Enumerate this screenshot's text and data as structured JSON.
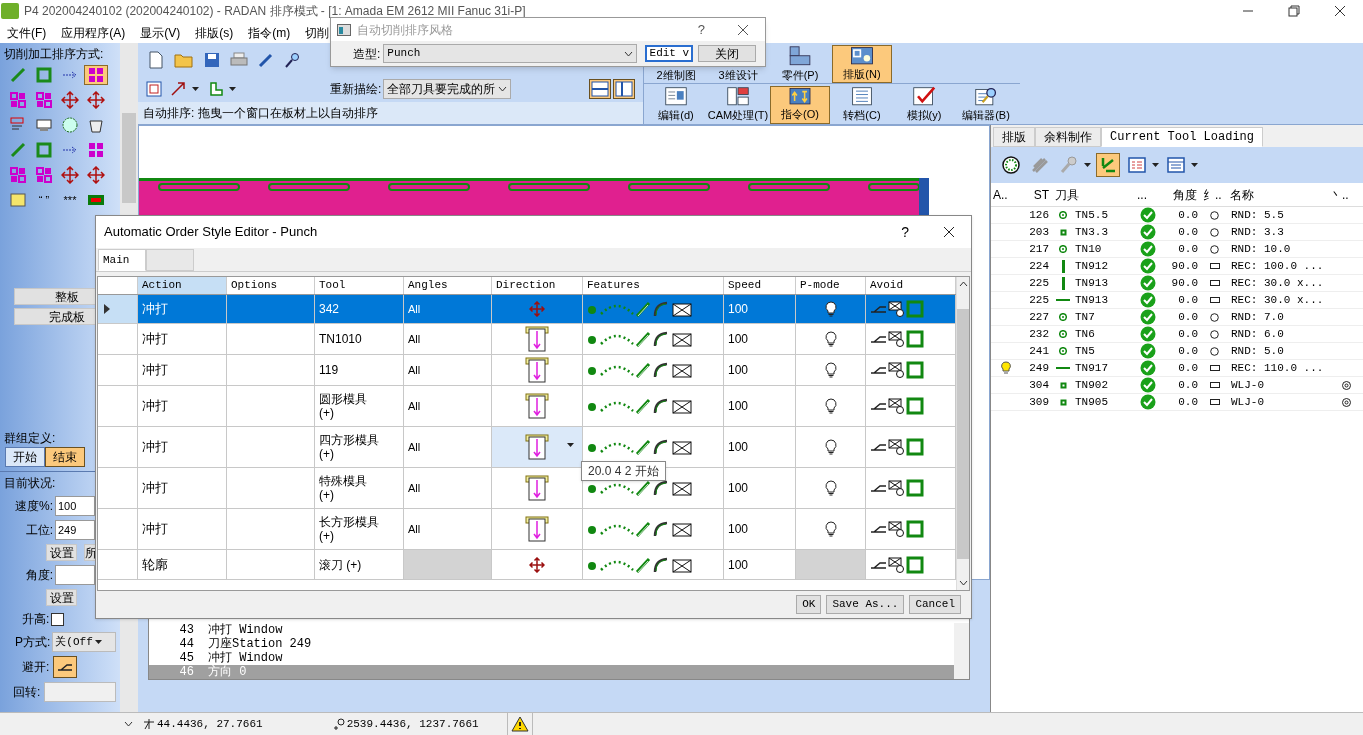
{
  "main_window": {
    "title": "P4 202004240102 (202004240102) - RADAN 排序模式 - [1: Amada EM 2612 MII Fanuc 31i-P]"
  },
  "menu": [
    "文件(F)",
    "应用程序(A)",
    "显示(V)",
    "排版(s)",
    "指令(m)",
    "切削"
  ],
  "left_panel": {
    "title": "切削加工排序方式:",
    "sort_tools": [
      {
        "kind": "icon",
        "selected": false
      },
      {
        "kind": "icon",
        "selected": false
      },
      {
        "kind": "icon",
        "selected": false
      },
      {
        "kind": "icon",
        "selected": true
      },
      {
        "kind": "icon",
        "selected": false
      },
      {
        "kind": "icon",
        "selected": false
      },
      {
        "kind": "icon",
        "selected": false
      },
      {
        "kind": "icon",
        "selected": false
      },
      {
        "kind": "icon",
        "selected": false
      },
      {
        "kind": "icon",
        "selected": false
      },
      {
        "kind": "icon",
        "selected": false
      },
      {
        "kind": "icon",
        "selected": false
      },
      {
        "kind": "icon",
        "selected": false
      },
      {
        "kind": "icon",
        "selected": false
      },
      {
        "kind": "icon",
        "selected": false
      },
      {
        "kind": "icon",
        "selected": false
      },
      {
        "kind": "icon",
        "selected": false
      },
      {
        "kind": "icon",
        "selected": false
      },
      {
        "kind": "icon",
        "selected": false
      },
      {
        "kind": "icon",
        "selected": false
      },
      {
        "kind": "icon",
        "selected": false
      },
      {
        "kind": "text",
        "label": "“ ”",
        "selected": false
      },
      {
        "kind": "text",
        "label": "***",
        "selected": false
      },
      {
        "kind": "icon",
        "selected": false
      }
    ],
    "buttons": [
      "整板",
      "完成板"
    ],
    "group_label": "群组定义:",
    "group_buttons": [
      {
        "label": "开始",
        "selected": false
      },
      {
        "label": "结束",
        "selected": true
      }
    ],
    "status_label": "目前状况:",
    "speed_label": "速度%:",
    "speed": "100",
    "station_label": "工位:",
    "station": "249",
    "set_button": "设置",
    "all_button": "所",
    "angle_label": "角度:",
    "angle_set_button": "设置",
    "raise_label": "升高:",
    "raise_checked": false,
    "pmode_label": "P方式:",
    "pmode": "关(Off",
    "avoid_label": "避开:",
    "avoid_on": true,
    "rotate_label": "回转:"
  },
  "toolbar": {
    "redraw_label": "重新描绘:",
    "redraw_value": "全部刀具要完成的所",
    "hint": "自动排序: 拖曳一个窗口在板材上以自动排序"
  },
  "ribbon": {
    "row1": [
      {
        "label": "2维制图",
        "kind": "label_only",
        "selected": false
      },
      {
        "label": "3维设计",
        "kind": "label_only",
        "selected": false
      },
      {
        "label": "零件(P)",
        "kind": "part",
        "selected": false
      },
      {
        "label": "排版(N)",
        "kind": "nest",
        "selected": true
      }
    ],
    "row2": [
      {
        "label": "编辑(d)",
        "kind": "edit",
        "selected": false
      },
      {
        "label": "CAM处理(T)",
        "kind": "cam",
        "selected": false
      },
      {
        "label": "指令(O)",
        "kind": "order",
        "selected": true
      },
      {
        "label": "转档(C)",
        "kind": "convert",
        "selected": false
      },
      {
        "label": "模拟(y)",
        "kind": "simulate",
        "selected": false
      },
      {
        "label": "编辑器(B)",
        "kind": "editor",
        "selected": false
      }
    ]
  },
  "nc_listing": [
    {
      "line": "43",
      "text": "冲打 Window",
      "selected": false
    },
    {
      "line": "44",
      "text": "刀座Station 249",
      "selected": false
    },
    {
      "line": "45",
      "text": "冲打 Window",
      "selected": false
    },
    {
      "line": "46",
      "text": "方向 0",
      "selected": true
    }
  ],
  "status_bar": {
    "cursor": "44.4436, 27.7661",
    "origin": "2539.4436, 1237.7661"
  },
  "right_panel": {
    "tabs": [
      {
        "label": "排版",
        "selected": false
      },
      {
        "label": "余料制作",
        "selected": false
      },
      {
        "label": "Current Tool Loading",
        "selected": true
      }
    ],
    "toolbar": [
      {
        "kind": "punch",
        "selected": false
      },
      {
        "kind": "tools",
        "selected": false
      },
      {
        "kind": "probe",
        "selected": false
      },
      {
        "kind": "angle",
        "selected": true
      },
      {
        "kind": "list",
        "selected": false
      },
      {
        "kind": "table",
        "selected": false
      }
    ],
    "columns": [
      "A..",
      "ST",
      "刀具",
      "...",
      "角度",
      "纟..",
      "名称",
      "丶.."
    ],
    "rows": [
      {
        "active": false,
        "st": "126",
        "kind": "round",
        "tool": "TN5.5",
        "angle": "0.0",
        "rectangular": false,
        "name": "RND: 5.5",
        "marked": false
      },
      {
        "active": false,
        "st": "203",
        "kind": "square",
        "tool": "TN3.3",
        "angle": "0.0",
        "rectangular": false,
        "name": "RND: 3.3",
        "marked": false
      },
      {
        "active": false,
        "st": "217",
        "kind": "round",
        "tool": "TN10",
        "angle": "0.0",
        "rectangular": false,
        "name": "RND: 10.0",
        "marked": false
      },
      {
        "active": false,
        "st": "224",
        "kind": "bar_v",
        "tool": "TN912",
        "angle": "90.0",
        "rectangular": true,
        "name": "REC: 100.0 ...",
        "marked": false
      },
      {
        "active": false,
        "st": "225",
        "kind": "bar_v",
        "tool": "TN913",
        "angle": "90.0",
        "rectangular": true,
        "name": "REC: 30.0 x...",
        "marked": false
      },
      {
        "active": false,
        "st": "225",
        "kind": "bar_h",
        "tool": "TN913",
        "angle": "0.0",
        "rectangular": true,
        "name": "REC: 30.0 x...",
        "marked": false
      },
      {
        "active": false,
        "st": "227",
        "kind": "round",
        "tool": "TN7",
        "angle": "0.0",
        "rectangular": false,
        "name": "RND: 7.0",
        "marked": false
      },
      {
        "active": false,
        "st": "232",
        "kind": "round",
        "tool": "TN6",
        "angle": "0.0",
        "rectangular": false,
        "name": "RND: 6.0",
        "marked": false
      },
      {
        "active": false,
        "st": "241",
        "kind": "round",
        "tool": "TN5",
        "angle": "0.0",
        "rectangular": false,
        "name": "RND: 5.0",
        "marked": false
      },
      {
        "active": true,
        "st": "249",
        "kind": "bar_h",
        "tool": "TN917",
        "angle": "0.0",
        "rectangular": true,
        "name": "REC: 110.0 ...",
        "marked": false
      },
      {
        "active": false,
        "st": "304",
        "kind": "square",
        "tool": "TN902",
        "angle": "0.0",
        "rectangular": true,
        "name": "WLJ-0",
        "marked": true
      },
      {
        "active": false,
        "st": "309",
        "kind": "square",
        "tool": "TN905",
        "angle": "0.0",
        "rectangular": true,
        "name": "WLJ-0",
        "marked": true
      }
    ]
  },
  "small_dialog": {
    "title": "自动切削排序风格",
    "help": "?",
    "style_label": "造型:",
    "style_value": "Punch",
    "edit_button": "Edit v",
    "close_button": "关闭"
  },
  "dialog": {
    "title": "Automatic Order Style Editor - Punch",
    "help": "?",
    "tabs": [
      {
        "label": "Main",
        "selected": true
      },
      {
        "selected": false
      }
    ],
    "columns": [
      "Action",
      "Options",
      "Tool",
      "Angles",
      "Direction",
      "Features",
      "Speed",
      "P-mode",
      "Avoid"
    ],
    "rows": [
      {
        "action": "冲打",
        "tool": "342",
        "angles": "All",
        "kind": "move",
        "speed": "100",
        "pmode": true,
        "selected": true,
        "editing": false
      },
      {
        "action": "冲打",
        "tool": "TN1010",
        "angles": "All",
        "kind": "down",
        "speed": "100",
        "pmode": true,
        "selected": false,
        "editing": false
      },
      {
        "action": "冲打",
        "tool": "119",
        "angles": "All",
        "kind": "down",
        "speed": "100",
        "pmode": true,
        "selected": false,
        "editing": false
      },
      {
        "action": "冲打",
        "tool": "圆形模具 (+)",
        "angles": "All",
        "kind": "down",
        "speed": "100",
        "pmode": true,
        "selected": false,
        "editing": false
      },
      {
        "action": "冲打",
        "tool": "四方形模具 (+)",
        "angles": "All",
        "kind": "down",
        "speed": "100",
        "pmode": true,
        "selected": false,
        "editing": true
      },
      {
        "action": "冲打",
        "tool": "特殊模具 (+)",
        "angles": "All",
        "kind": "down",
        "speed": "100",
        "pmode": true,
        "selected": false,
        "editing": false
      },
      {
        "action": "冲打",
        "tool": "长方形模具 (+)",
        "angles": "All",
        "kind": "down",
        "speed": "100",
        "pmode": true,
        "selected": false,
        "editing": false
      },
      {
        "action": "轮廓",
        "tool": "滚刀 (+)",
        "kind": "move",
        "speed": "100",
        "pmode": false,
        "selected": false,
        "editing": false
      }
    ],
    "tooltip": "20.0 4 2 开始",
    "buttons": [
      "OK",
      "Save As...",
      "Cancel"
    ]
  }
}
